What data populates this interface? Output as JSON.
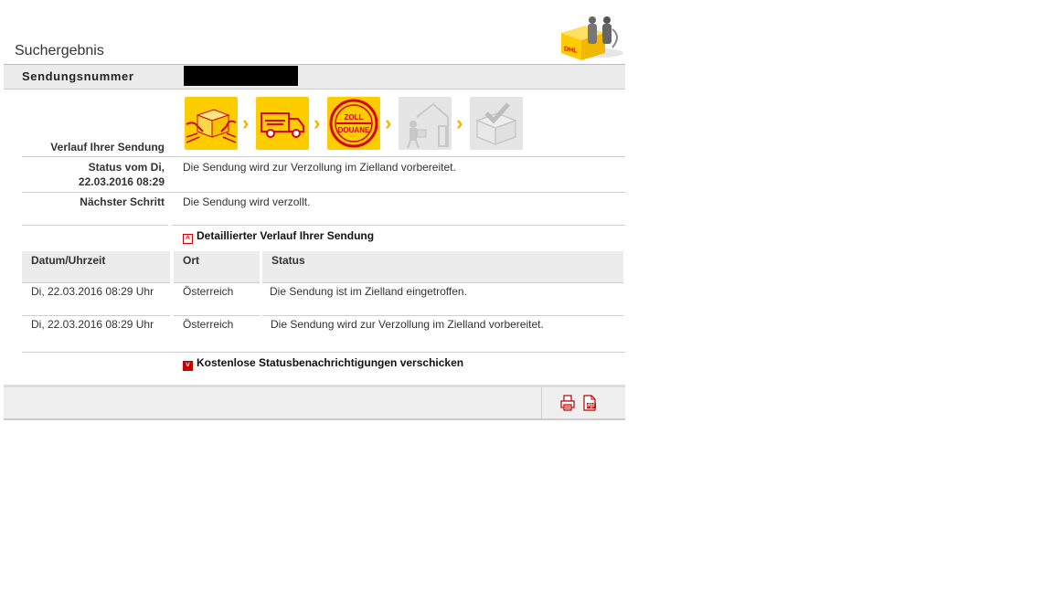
{
  "page": {
    "title": "Suchergebnis"
  },
  "shipment": {
    "number_label": "Sendungsnummer",
    "number_value": ""
  },
  "progress": {
    "label": "Verlauf Ihrer Sendung",
    "steps": [
      {
        "name": "pickup",
        "state": "done"
      },
      {
        "name": "transport",
        "state": "done"
      },
      {
        "name": "customs",
        "state": "current",
        "text_line1": "ZOLL",
        "text_line2": "DOUANE"
      },
      {
        "name": "delivery",
        "state": "pending"
      },
      {
        "name": "delivered",
        "state": "pending"
      }
    ]
  },
  "status": {
    "label_line1": "Status vom Di,",
    "label_line2": "22.03.2016 08:29",
    "text": "Die Sendung wird zur Verzollung im Zielland vorbereitet."
  },
  "next_step": {
    "label": "Nächster Schritt",
    "text": "Die Sendung wird verzollt."
  },
  "detail": {
    "toggle_label": "Detaillierter Verlauf Ihrer Sendung",
    "columns": [
      "Datum/Uhrzeit",
      "Ort",
      "Status"
    ],
    "rows": [
      {
        "datetime": "Di, 22.03.2016 08:29 Uhr",
        "location": "Österreich",
        "status": "Die Sendung ist im Zielland eingetroffen."
      },
      {
        "datetime": "Di, 22.03.2016 08:29 Uhr",
        "location": "Österreich",
        "status": "Die Sendung wird zur Verzollung im Zielland vorbereitet."
      }
    ]
  },
  "notifications": {
    "label": "Kostenlose Statusbenachrichtigungen verschicken"
  },
  "colors": {
    "brand_yellow": "#FFCC00",
    "brand_red": "#D40511",
    "chevron": "#F5B400"
  },
  "icons": {
    "logo": "dhl-logo-icon",
    "print": "printer-icon",
    "pdf": "pdf-icon"
  }
}
